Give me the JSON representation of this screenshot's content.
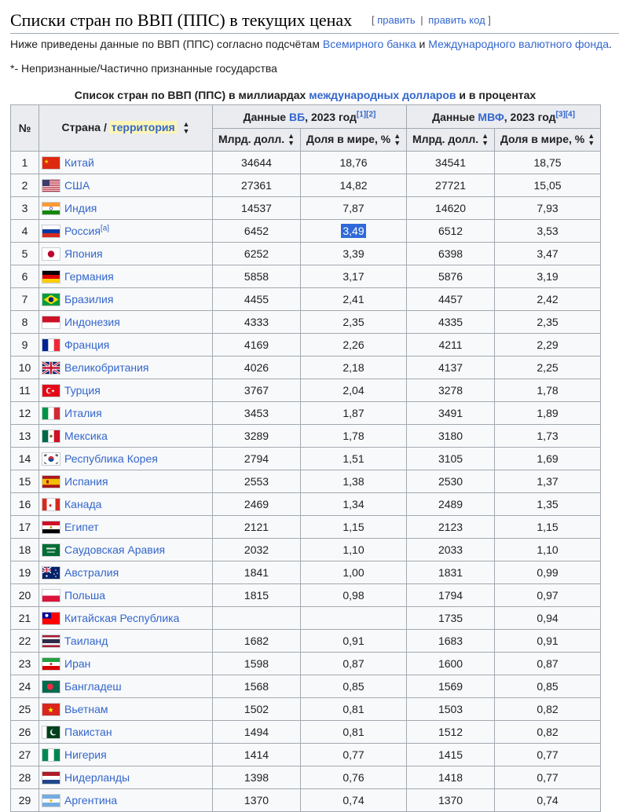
{
  "heading": {
    "title": "Списки стран по ВВП (ППС) в текущих ценах",
    "edit": "править",
    "edit_code": "править код",
    "bracket_open": "[",
    "bracket_close": "]",
    "pipe": "|"
  },
  "intro": {
    "text_before": "Ниже приведены данные по ВВП (ППС) согласно подсчётам ",
    "link1": "Всемирного банка",
    "mid": " и ",
    "link2": "Международного валютного фонда",
    "end": "."
  },
  "note": "*- Непризнанные/Частично признанные государства",
  "caption": {
    "before": "Список стран по ВВП (ППС) в миллиардах ",
    "link": "международных долларов",
    "after": " и в процентах"
  },
  "headers": {
    "num": "№",
    "country": "Страна / ",
    "territory": "территория",
    "wb_before": "Данные ",
    "wb_link": "ВБ",
    "wb_after": ", 2023 год",
    "wb_refs": "[1][2]",
    "imf_before": "Данные ",
    "imf_link": "МВФ",
    "imf_after": ", 2023 год",
    "imf_refs": "[3][4]",
    "bln": "Млрд. долл.",
    "share": "Доля в мире, %"
  },
  "colors": {
    "link": "#3366cc",
    "header_bg": "#eaecf0",
    "cell_bg": "#f8f9fa",
    "border": "#a2a9b1",
    "highlight": "#fef6b5",
    "selection": "#2f6ad8"
  },
  "rows": [
    {
      "n": "1",
      "country": "Китай",
      "flag": "china",
      "wb": "34644",
      "wbs": "18,76",
      "imf": "34541",
      "imfs": "18,75"
    },
    {
      "n": "2",
      "country": "США",
      "flag": "usa",
      "wb": "27361",
      "wbs": "14,82",
      "imf": "27721",
      "imfs": "15,05"
    },
    {
      "n": "3",
      "country": "Индия",
      "flag": "india",
      "wb": "14537",
      "wbs": "7,87",
      "imf": "14620",
      "imfs": "7,93"
    },
    {
      "n": "4",
      "country": "Россия",
      "note": "[a]",
      "flag": "russia",
      "wb": "6452",
      "wbs": "3,49",
      "imf": "6512",
      "imfs": "3,53",
      "selected": true
    },
    {
      "n": "5",
      "country": "Япония",
      "flag": "japan",
      "wb": "6252",
      "wbs": "3,39",
      "imf": "6398",
      "imfs": "3,47"
    },
    {
      "n": "6",
      "country": "Германия",
      "flag": "germany",
      "wb": "5858",
      "wbs": "3,17",
      "imf": "5876",
      "imfs": "3,19"
    },
    {
      "n": "7",
      "country": "Бразилия",
      "flag": "brazil",
      "wb": "4455",
      "wbs": "2,41",
      "imf": "4457",
      "imfs": "2,42"
    },
    {
      "n": "8",
      "country": "Индонезия",
      "flag": "indonesia",
      "wb": "4333",
      "wbs": "2,35",
      "imf": "4335",
      "imfs": "2,35"
    },
    {
      "n": "9",
      "country": "Франция",
      "flag": "france",
      "wb": "4169",
      "wbs": "2,26",
      "imf": "4211",
      "imfs": "2,29"
    },
    {
      "n": "10",
      "country": "Великобритания",
      "flag": "uk",
      "wb": "4026",
      "wbs": "2,18",
      "imf": "4137",
      "imfs": "2,25"
    },
    {
      "n": "11",
      "country": "Турция",
      "flag": "turkey",
      "wb": "3767",
      "wbs": "2,04",
      "imf": "3278",
      "imfs": "1,78"
    },
    {
      "n": "12",
      "country": "Италия",
      "flag": "italy",
      "wb": "3453",
      "wbs": "1,87",
      "imf": "3491",
      "imfs": "1,89"
    },
    {
      "n": "13",
      "country": "Мексика",
      "flag": "mexico",
      "wb": "3289",
      "wbs": "1,78",
      "imf": "3180",
      "imfs": "1,73"
    },
    {
      "n": "14",
      "country": "Республика Корея",
      "flag": "korea",
      "wb": "2794",
      "wbs": "1,51",
      "imf": "3105",
      "imfs": "1,69"
    },
    {
      "n": "15",
      "country": "Испания",
      "flag": "spain",
      "wb": "2553",
      "wbs": "1,38",
      "imf": "2530",
      "imfs": "1,37"
    },
    {
      "n": "16",
      "country": "Канада",
      "flag": "canada",
      "wb": "2469",
      "wbs": "1,34",
      "imf": "2489",
      "imfs": "1,35"
    },
    {
      "n": "17",
      "country": "Египет",
      "flag": "egypt",
      "wb": "2121",
      "wbs": "1,15",
      "imf": "2123",
      "imfs": "1,15"
    },
    {
      "n": "18",
      "country": "Саудовская Аравия",
      "flag": "saudi",
      "wb": "2032",
      "wbs": "1,10",
      "imf": "2033",
      "imfs": "1,10"
    },
    {
      "n": "19",
      "country": "Австралия",
      "flag": "australia",
      "wb": "1841",
      "wbs": "1,00",
      "imf": "1831",
      "imfs": "0,99"
    },
    {
      "n": "20",
      "country": "Польша",
      "flag": "poland",
      "wb": "1815",
      "wbs": "0,98",
      "imf": "1794",
      "imfs": "0,97"
    },
    {
      "n": "21",
      "country": "Китайская Республика",
      "flag": "taiwan",
      "wb": "",
      "wbs": "",
      "imf": "1735",
      "imfs": "0,94"
    },
    {
      "n": "22",
      "country": "Таиланд",
      "flag": "thailand",
      "wb": "1682",
      "wbs": "0,91",
      "imf": "1683",
      "imfs": "0,91"
    },
    {
      "n": "23",
      "country": "Иран",
      "flag": "iran",
      "wb": "1598",
      "wbs": "0,87",
      "imf": "1600",
      "imfs": "0,87"
    },
    {
      "n": "24",
      "country": "Бангладеш",
      "flag": "bangladesh",
      "wb": "1568",
      "wbs": "0,85",
      "imf": "1569",
      "imfs": "0,85"
    },
    {
      "n": "25",
      "country": "Вьетнам",
      "flag": "vietnam",
      "wb": "1502",
      "wbs": "0,81",
      "imf": "1503",
      "imfs": "0,82"
    },
    {
      "n": "26",
      "country": "Пакистан",
      "flag": "pakistan",
      "wb": "1494",
      "wbs": "0,81",
      "imf": "1512",
      "imfs": "0,82"
    },
    {
      "n": "27",
      "country": "Нигерия",
      "flag": "nigeria",
      "wb": "1414",
      "wbs": "0,77",
      "imf": "1415",
      "imfs": "0,77"
    },
    {
      "n": "28",
      "country": "Нидерланды",
      "flag": "netherlands",
      "wb": "1398",
      "wbs": "0,76",
      "imf": "1418",
      "imfs": "0,77"
    },
    {
      "n": "29",
      "country": "Аргентина",
      "flag": "argentina",
      "wb": "1370",
      "wbs": "0,74",
      "imf": "1370",
      "imfs": "0,74"
    }
  ]
}
